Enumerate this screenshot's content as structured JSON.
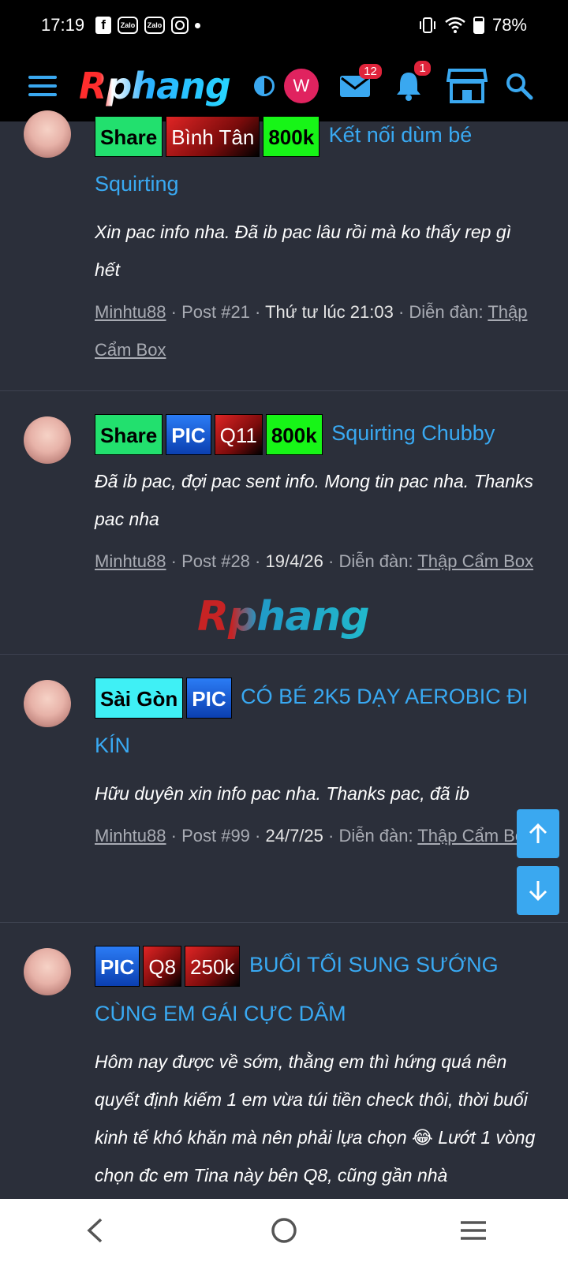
{
  "status_bar": {
    "time": "17:19",
    "zalo_label": "Zalo",
    "battery": "78%"
  },
  "header": {
    "logo": "Rphang",
    "profile_initial": "W",
    "messages_count": "12",
    "notifications_count": "1"
  },
  "posts": [
    {
      "tags": [
        {
          "label": "Share",
          "style": "share"
        },
        {
          "label": "Bình Tân",
          "style": "red"
        },
        {
          "label": "800k",
          "style": "green"
        }
      ],
      "title": "Kết nối dùm bé Squirting",
      "excerpt": "Xin pac info nha. Đã ib pac lâu rồi mà ko thấy rep gì hết",
      "author": "Minhtu88",
      "post_number": "Post #21",
      "date": "Thứ tư lúc 21:03",
      "forum_label": "Diễn đàn:",
      "forum": "Thập Cẩm Box"
    },
    {
      "tags": [
        {
          "label": "Share",
          "style": "share"
        },
        {
          "label": "PIC",
          "style": "pic"
        },
        {
          "label": "Q11",
          "style": "red"
        },
        {
          "label": "800k",
          "style": "green"
        }
      ],
      "title": "Squirting Chubby",
      "excerpt": "Đã ib pac, đợi pac sent info. Mong tin pac nha. Thanks pac nha",
      "author": "Minhtu88",
      "post_number": "Post #28",
      "date": "19/4/26",
      "forum_label": "Diễn đàn:",
      "forum": "Thập Cẩm Box"
    },
    {
      "tags": [
        {
          "label": "Sài Gòn",
          "style": "cyan"
        },
        {
          "label": "PIC",
          "style": "pic"
        }
      ],
      "title": "CÓ BÉ 2K5 DẠY AEROBIC ĐI KÍN",
      "excerpt": "Hữu duyên xin info pac nha. Thanks pac, đã ib",
      "author": "Minhtu88",
      "post_number": "Post #99",
      "date": "24/7/25",
      "forum_label": "Diễn đàn:",
      "forum": "Thập Cẩm Box"
    },
    {
      "tags": [
        {
          "label": "PIC",
          "style": "pic"
        },
        {
          "label": "Q8",
          "style": "red"
        },
        {
          "label": "250k",
          "style": "red"
        }
      ],
      "title": "BUỔI TỐI SUNG SƯỚNG CÙNG EM GÁI CỰC DÂM",
      "excerpt": "Hôm nay được về sớm, thằng em thì hứng quá nên quyết định kiếm 1 em vừa túi tiền check thôi, thời buổi kinh tế khó khăn mà nên phải lựa chọn 😂 Lướt 1 vòng chọn đc em Tina này bên Q8, cũng gần nhà",
      "author": "",
      "post_number": "",
      "date": "",
      "forum_label": "",
      "forum": ""
    }
  ],
  "watermark": "Rphang",
  "colors": {
    "accent": "#3aa8f0",
    "background": "#2b2f3a",
    "header_bg": "#000000",
    "link": "#39a9f2"
  }
}
